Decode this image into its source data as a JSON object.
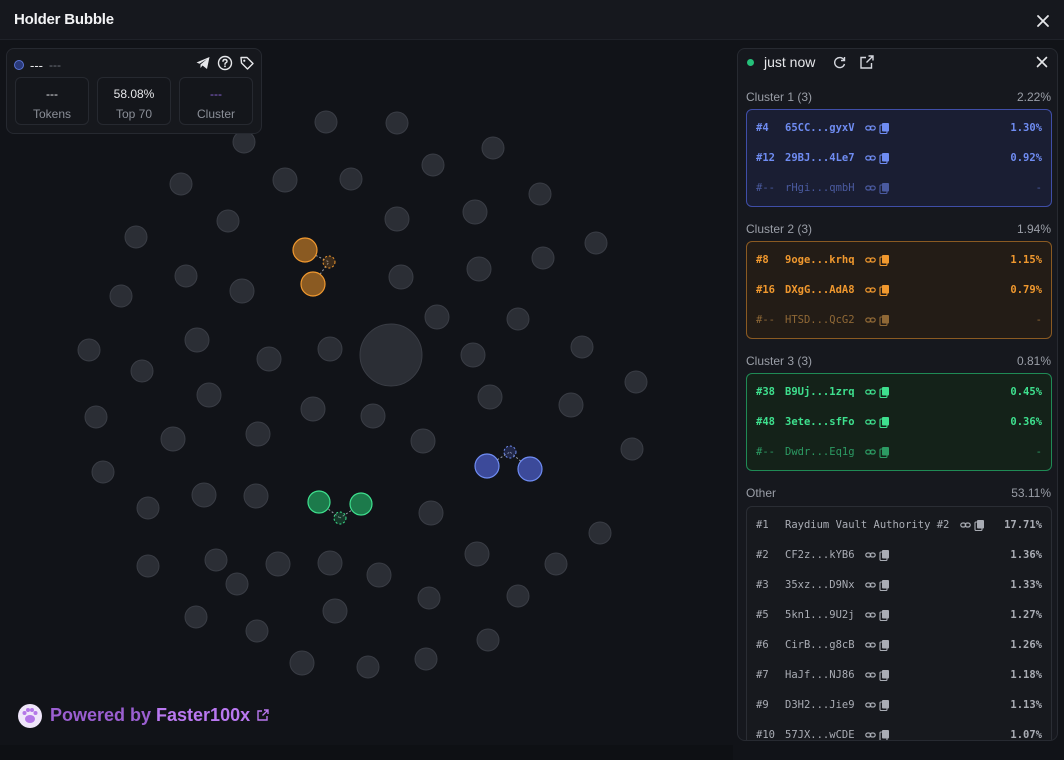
{
  "window": {
    "title": "Holder Bubble"
  },
  "stats": {
    "name": "---",
    "subtitle": "---",
    "boxes": [
      {
        "value": "---",
        "label": "Tokens"
      },
      {
        "value": "58.08%",
        "label": "Top 70"
      },
      {
        "value": "---",
        "label": "Cluster",
        "value_color": "#8a64d6"
      }
    ],
    "icons": [
      "telegram-icon",
      "help-icon",
      "tag-icon"
    ]
  },
  "powered": {
    "prefix": "Powered by",
    "brand": "Faster100x"
  },
  "panel": {
    "status": "just now",
    "clusters": [
      {
        "title": "Cluster 1 (3)",
        "pct": "2.22%",
        "color": "#6f8cf2",
        "rows": [
          {
            "rank": "#4",
            "addr": "65CC...gyxV",
            "pct": "1.30%"
          },
          {
            "rank": "#12",
            "addr": "29BJ...4Le7",
            "pct": "0.92%"
          },
          {
            "rank": "#--",
            "addr": "rHgi...qmbH",
            "pct": "-"
          }
        ]
      },
      {
        "title": "Cluster 2 (3)",
        "pct": "1.94%",
        "color": "#f0982e",
        "rows": [
          {
            "rank": "#8",
            "addr": "9oge...krhq",
            "pct": "1.15%"
          },
          {
            "rank": "#16",
            "addr": "DXgG...AdA8",
            "pct": "0.79%"
          },
          {
            "rank": "#--",
            "addr": "HTSD...QcG2",
            "pct": "-"
          }
        ]
      },
      {
        "title": "Cluster 3 (3)",
        "pct": "0.81%",
        "color": "#3ee08e",
        "rows": [
          {
            "rank": "#38",
            "addr": "B9Uj...1zrq",
            "pct": "0.45%"
          },
          {
            "rank": "#48",
            "addr": "3ete...sfFo",
            "pct": "0.36%"
          },
          {
            "rank": "#--",
            "addr": "Dwdr...Eq1g",
            "pct": "-"
          }
        ]
      }
    ],
    "other": {
      "title": "Other",
      "pct": "53.11%",
      "rows": [
        {
          "rank": "#1",
          "addr": "Raydium Vault Authority #2",
          "pct": "17.71%"
        },
        {
          "rank": "#2",
          "addr": "CF2z...kYB6",
          "pct": "1.36%"
        },
        {
          "rank": "#3",
          "addr": "35xz...D9Nx",
          "pct": "1.33%"
        },
        {
          "rank": "#5",
          "addr": "5kn1...9U2j",
          "pct": "1.27%"
        },
        {
          "rank": "#6",
          "addr": "CirB...g8cB",
          "pct": "1.26%"
        },
        {
          "rank": "#7",
          "addr": "HaJf...NJ86",
          "pct": "1.18%"
        },
        {
          "rank": "#9",
          "addr": "D3H2...Jie9",
          "pct": "1.13%"
        },
        {
          "rank": "#10",
          "addr": "57JX...wCDE",
          "pct": "1.07%"
        }
      ]
    }
  }
}
